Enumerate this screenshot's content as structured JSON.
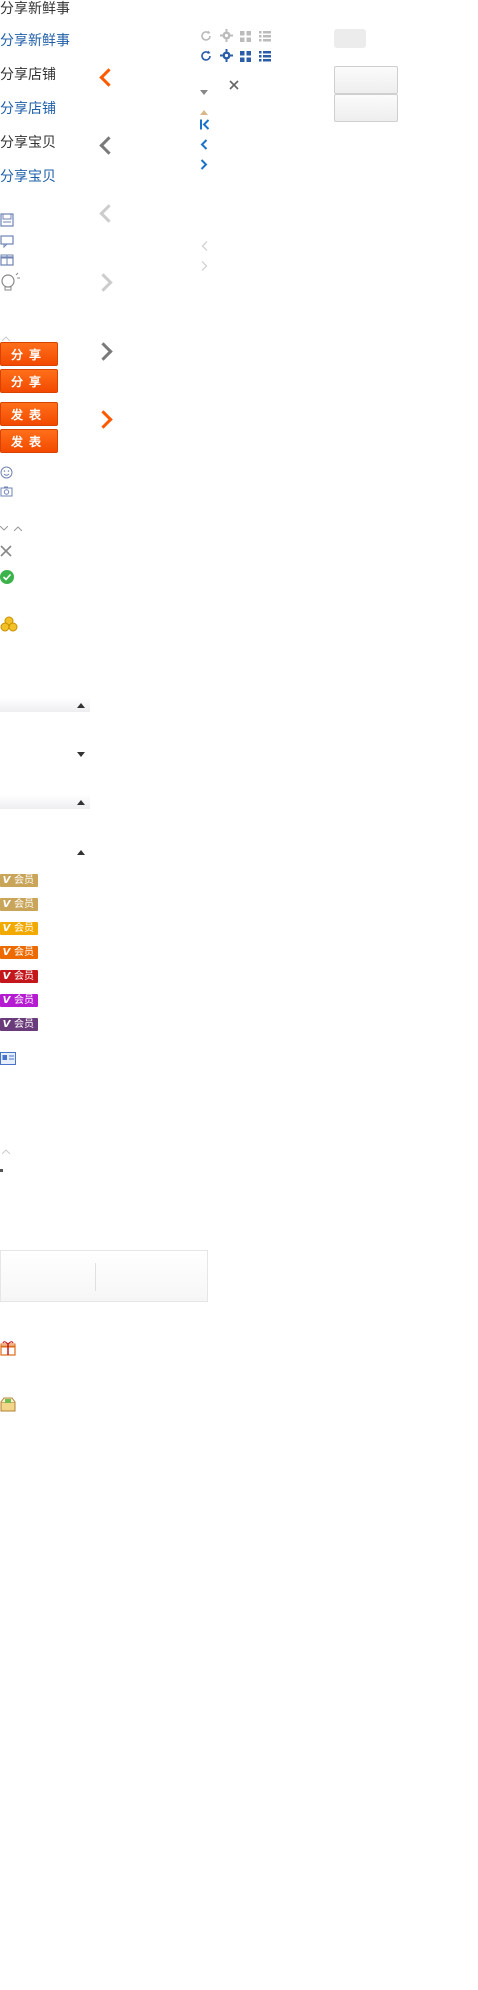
{
  "share": {
    "news_dark": "分享新鲜事",
    "news_blue": "分享新鲜事",
    "shop_dark": "分享店铺",
    "shop_blue": "分享店铺",
    "item_dark": "分享宝贝",
    "item_blue": "分享宝贝"
  },
  "buttons": {
    "share_a": "分享",
    "share_b": "分享",
    "post_a": "发表",
    "post_b": "发表"
  },
  "vip": {
    "label": "会员",
    "colors": [
      "#c9a55a",
      "#c9a55a",
      "#f2a900",
      "#ec6a00",
      "#c4171c",
      "#b51bd1",
      "#6a3b7a"
    ]
  },
  "icons": {
    "refresh": "refresh-icon",
    "gear": "gear-icon",
    "grid": "grid-view-icon",
    "list": "list-view-icon",
    "close": "close-icon",
    "check": "check-circle-icon",
    "coins": "coins-icon",
    "smile": "emoji-icon",
    "camera": "camera-icon",
    "gift": "gift-icon",
    "package": "package-icon"
  },
  "accent_orange": "#ff5a00",
  "link_blue": "#1a73c8"
}
